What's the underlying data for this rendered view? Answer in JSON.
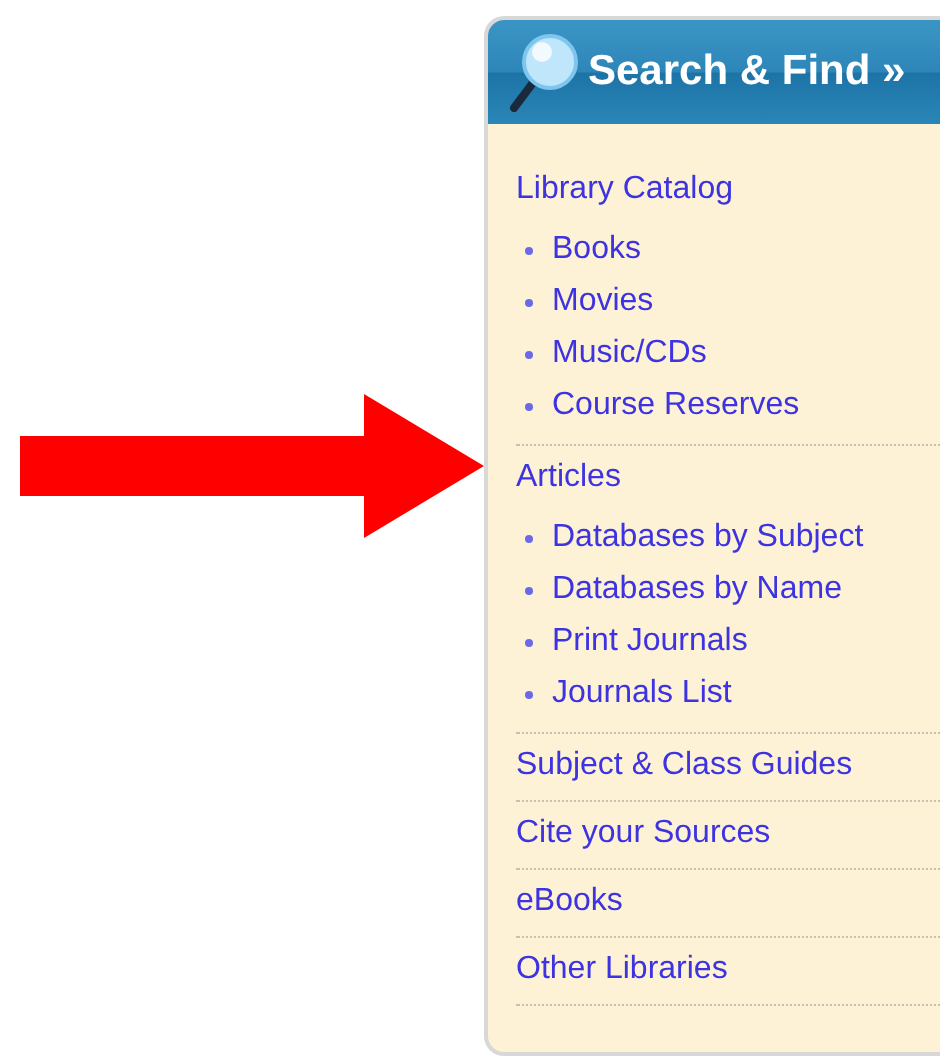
{
  "panel": {
    "title": "Search & Find »",
    "sections": [
      {
        "label": "Library Catalog",
        "children": [
          "Books",
          "Movies",
          "Music/CDs",
          "Course Reserves"
        ]
      },
      {
        "label": "Articles",
        "children": [
          "Databases by Subject",
          "Databases by Name",
          "Print Journals",
          "Journals List"
        ]
      },
      {
        "label": "Subject & Class Guides"
      },
      {
        "label": "Cite your Sources"
      },
      {
        "label": "eBooks"
      },
      {
        "label": "Other Libraries"
      }
    ]
  }
}
